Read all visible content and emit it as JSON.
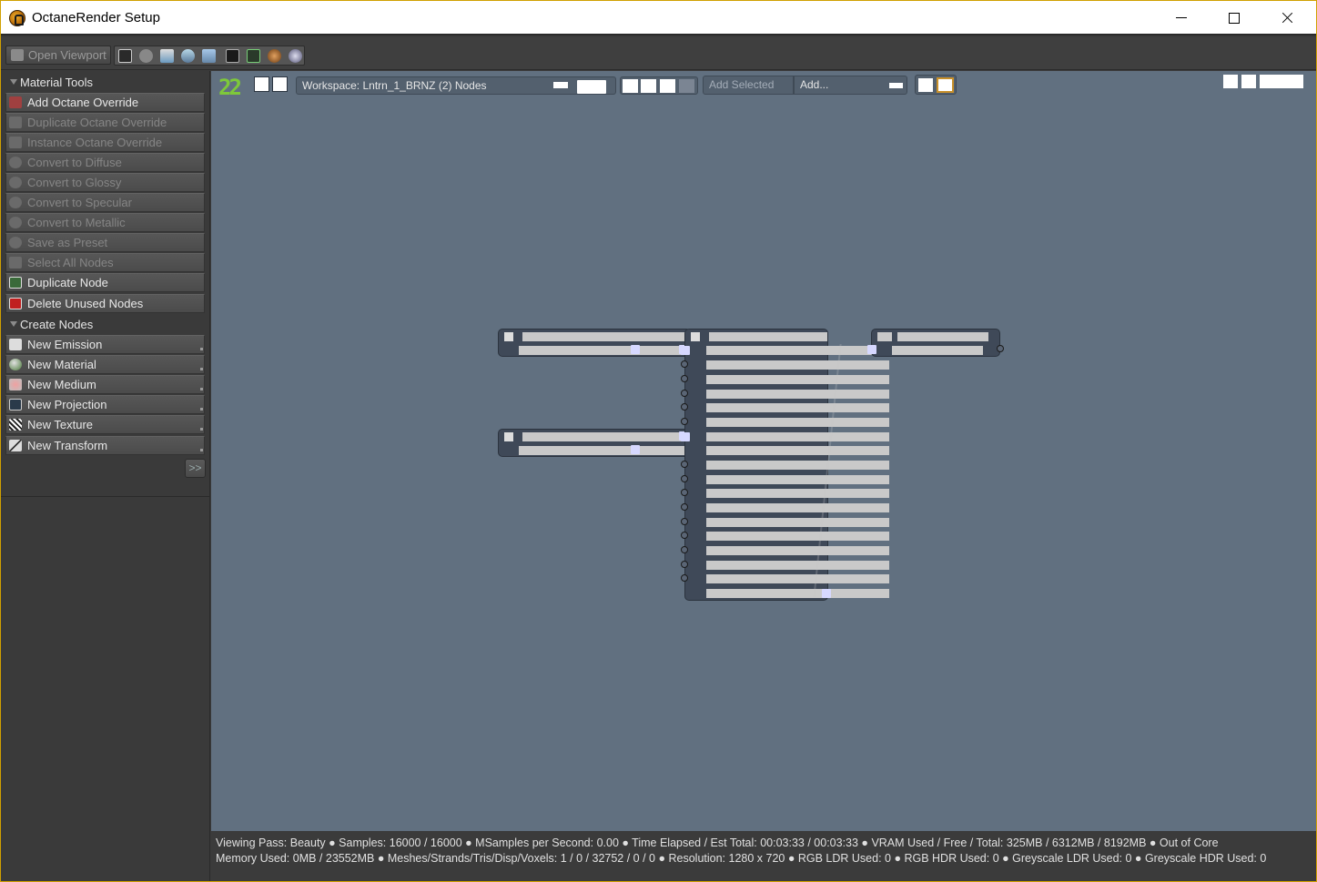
{
  "window": {
    "title": "OctaneRender Setup"
  },
  "toolbar": {
    "open_viewport_label": "Open Viewport",
    "icons": [
      "node-graph-icon",
      "camera-icon",
      "render-settings-icon",
      "kernel-icon",
      "layers-icon",
      "console-icon",
      "monitor-icon",
      "material-ball-icon",
      "settings-wheel-icon"
    ]
  },
  "sidebar": {
    "material_tools": {
      "header": "Material Tools",
      "items": [
        {
          "label": "Add Octane Override",
          "enabled": true
        },
        {
          "label": "Duplicate Octane Override",
          "enabled": false
        },
        {
          "label": "Instance Octane Override",
          "enabled": false
        },
        {
          "label": "Convert to Diffuse",
          "enabled": false
        },
        {
          "label": "Convert to Glossy",
          "enabled": false
        },
        {
          "label": "Convert to Specular",
          "enabled": false
        },
        {
          "label": "Convert to Metallic",
          "enabled": false
        },
        {
          "label": "Save as Preset",
          "enabled": false
        },
        {
          "label": "Select All Nodes",
          "enabled": false
        },
        {
          "label": "Duplicate Node",
          "enabled": true
        },
        {
          "label": "Delete Unused Nodes",
          "enabled": true
        }
      ]
    },
    "create_nodes": {
      "header": "Create Nodes",
      "items": [
        {
          "label": "New Emission"
        },
        {
          "label": "New Material"
        },
        {
          "label": "New Medium"
        },
        {
          "label": "New Projection"
        },
        {
          "label": "New Texture"
        },
        {
          "label": "New Transform"
        }
      ]
    },
    "expand_label": ">>"
  },
  "editor": {
    "logo": "22",
    "workspace_label": "Workspace: Lntrn_1_BRNZ (2) Nodes",
    "add_selected_label": "Add Selected",
    "add_dropdown_label": "Add..."
  },
  "status": {
    "line1": "Viewing Pass: Beauty ●  Samples: 16000  / 16000 ●  MSamples per Second: 0.00 ●  Time Elapsed / Est Total: 00:03:33 / 00:03:33 ●  VRAM Used / Free / Total: 325MB / 6312MB / 8192MB ●  Out of Core",
    "line2": "Memory Used: 0MB / 23552MB ●  Meshes/Strands/Tris/Disp/Voxels: 1 / 0 / 32752 / 0 / 0 ●  Resolution: 1280 x 720 ●  RGB LDR Used: 0 ●  RGB HDR Used: 0 ●  Greyscale LDR Used: 0 ●  Greyscale HDR Used: 0"
  },
  "colors": {
    "editor_bg": "#617080",
    "logo_green": "#7ec83a",
    "pin_color": "#d6d8ff",
    "active_outline": "#c8902a"
  }
}
